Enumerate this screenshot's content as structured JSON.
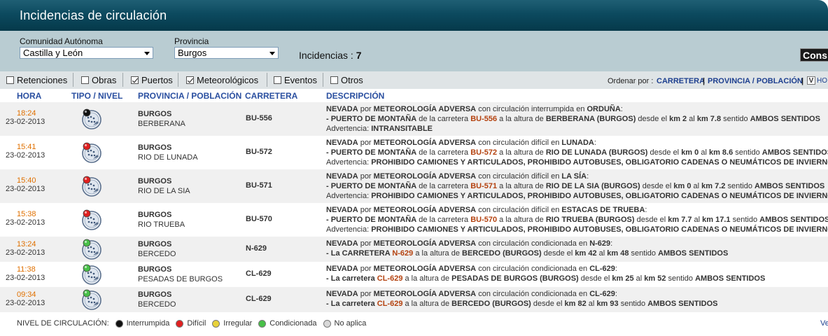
{
  "header": {
    "title": "Incidencias de circulación"
  },
  "filters": {
    "comunidad_label": "Comunidad Autónoma",
    "comunidad_value": "Castilla y León",
    "provincia_label": "Provincia",
    "provincia_value": "Burgos",
    "incidencias_label": "Incidencias :",
    "incidencias_count": "7",
    "consultar_label": "Cons"
  },
  "checks": [
    {
      "label": "Retenciones",
      "checked": false
    },
    {
      "label": "Obras",
      "checked": false
    },
    {
      "label": "Puertos",
      "checked": true
    },
    {
      "label": "Meteorológicos",
      "checked": true
    },
    {
      "label": "Eventos",
      "checked": false
    },
    {
      "label": "Otros",
      "checked": false
    }
  ],
  "order": {
    "label": "Ordenar por :",
    "carretera": "CARRETERA",
    "sep": "|",
    "provincia": "PROVINCIA / POBLACIÓN",
    "v": "V",
    "ho": "HO"
  },
  "columns": {
    "hora": "HORA",
    "tipo": "TIPO / NIVEL",
    "provincia": "PROVINCIA / POBLACIÓN",
    "carretera": "CARRETERA",
    "descripcion": "DESCRIPCIÓN"
  },
  "colors": {
    "negro": "#111111",
    "rojo": "#e02020",
    "amarillo": "#e8d23a",
    "verde": "#48c048",
    "gris": "#d8d8d8"
  },
  "rows": [
    {
      "time": "18:24",
      "date": "23-02-2013",
      "level": "negro",
      "provincia": "BURGOS",
      "poblacion": "BERBERANA",
      "road": "BU-556",
      "d1": [
        "NEVADA",
        " por ",
        "METEOROLOGÍA ADVERSA",
        " con circulación interrumpida en ",
        "ORDUÑA",
        ":"
      ],
      "d2": [
        "- PUERTO DE MONTAÑA",
        " de la carretera ",
        "BU-556",
        " a la altura de ",
        "BERBERANA (BURGOS)",
        " desde el ",
        "km 2",
        " al ",
        "km 7.8",
        " sentido ",
        "AMBOS SENTIDOS"
      ],
      "d3": [
        "Advertencia: ",
        "INTRANSITABLE"
      ]
    },
    {
      "time": "15:41",
      "date": "23-02-2013",
      "level": "rojo",
      "provincia": "BURGOS",
      "poblacion": "RIO DE LUNADA",
      "road": "BU-572",
      "d1": [
        "NEVADA",
        " por ",
        "METEOROLOGÍA ADVERSA",
        " con circulación difícil en ",
        "LUNADA",
        ":"
      ],
      "d2": [
        "- PUERTO DE MONTAÑA",
        " de la carretera ",
        "BU-572",
        " a la altura de ",
        "RIO DE LUNADA (BURGOS)",
        " desde el ",
        "km 0",
        " al ",
        "km 8.6",
        " sentido ",
        "AMBOS SENTIDOS"
      ],
      "d3": [
        "Advertencia: ",
        "PROHIBIDO CAMIONES Y ARTICULADOS, PROHIBIDO AUTOBUSES, OBLIGATORIO CADENAS O NEUMÁTICOS DE INVIERNO"
      ]
    },
    {
      "time": "15:40",
      "date": "23-02-2013",
      "level": "rojo",
      "provincia": "BURGOS",
      "poblacion": "RIO DE LA SIA",
      "road": "BU-571",
      "d1": [
        "NEVADA",
        " por ",
        "METEOROLOGÍA ADVERSA",
        " con circulación difícil en ",
        "LA SÍA",
        ":"
      ],
      "d2": [
        "- PUERTO DE MONTAÑA",
        " de la carretera ",
        "BU-571",
        " a la altura de ",
        "RIO DE LA SIA (BURGOS)",
        " desde el ",
        "km 0",
        " al ",
        "km 7.2",
        " sentido ",
        "AMBOS SENTIDOS"
      ],
      "d3": [
        "Advertencia: ",
        "PROHIBIDO CAMIONES Y ARTICULADOS, PROHIBIDO AUTOBUSES, OBLIGATORIO CADENAS O NEUMÁTICOS DE INVIERNO"
      ]
    },
    {
      "time": "15:38",
      "date": "23-02-2013",
      "level": "rojo",
      "provincia": "BURGOS",
      "poblacion": "RIO TRUEBA",
      "road": "BU-570",
      "d1": [
        "NEVADA",
        " por ",
        "METEOROLOGÍA ADVERSA",
        " con circulación difícil en ",
        "ESTACAS DE TRUEBA",
        ":"
      ],
      "d2": [
        "- PUERTO DE MONTAÑA",
        " de la carretera ",
        "BU-570",
        " a la altura de ",
        "RIO TRUEBA (BURGOS)",
        " desde el ",
        "km 7.7",
        " al ",
        "km 17.1",
        " sentido ",
        "AMBOS SENTIDOS"
      ],
      "d3": [
        "Advertencia: ",
        "PROHIBIDO CAMIONES Y ARTICULADOS, PROHIBIDO AUTOBUSES, OBLIGATORIO CADENAS O NEUMÁTICOS DE INVIERNO"
      ]
    },
    {
      "time": "13:24",
      "date": "23-02-2013",
      "level": "verde",
      "provincia": "BURGOS",
      "poblacion": "BERCEDO",
      "road": "N-629",
      "d1": [
        "NEVADA",
        " por ",
        "METEOROLOGÍA ADVERSA",
        " con circulación condicionada en ",
        "N-629",
        ":"
      ],
      "d2": [
        "- La CARRETERA ",
        "",
        "N-629",
        " a la altura de ",
        "BERCEDO (BURGOS)",
        " desde el ",
        "km 42",
        " al ",
        "km 48",
        " sentido ",
        "AMBOS SENTIDOS"
      ],
      "d3": null
    },
    {
      "time": "11:38",
      "date": "23-02-2013",
      "level": "verde",
      "provincia": "BURGOS",
      "poblacion": "PESADAS DE BURGOS",
      "road": "CL-629",
      "d1": [
        "NEVADA",
        " por ",
        "METEOROLOGÍA ADVERSA",
        " con circulación condicionada en ",
        "CL-629",
        ":"
      ],
      "d2": [
        "- La carretera ",
        "",
        "CL-629",
        " a la altura de ",
        "PESADAS DE BURGOS (BURGOS)",
        " desde el ",
        "km 25",
        " al ",
        "km 52",
        " sentido ",
        "AMBOS SENTIDOS"
      ],
      "d3": null
    },
    {
      "time": "09:34",
      "date": "23-02-2013",
      "level": "verde",
      "provincia": "BURGOS",
      "poblacion": "BERCEDO",
      "road": "CL-629",
      "d1": [
        "NEVADA",
        " por ",
        "METEOROLOGÍA ADVERSA",
        " con circulación condicionada en ",
        "CL-629",
        ":"
      ],
      "d2": [
        "- La carretera ",
        "",
        "CL-629",
        " a la altura de ",
        "BERCEDO (BURGOS)",
        " desde el ",
        "km 82",
        " al ",
        "km 93",
        " sentido ",
        "AMBOS SENTIDOS"
      ],
      "d3": null
    }
  ],
  "legend": {
    "title": "NIVEL DE CIRCULACIÓN:",
    "items": [
      {
        "label": "Interrumpida",
        "level": "negro"
      },
      {
        "label": "Difícil",
        "level": "rojo"
      },
      {
        "label": "Irregular",
        "level": "amarillo"
      },
      {
        "label": "Condicionada",
        "level": "verde"
      },
      {
        "label": "No aplica",
        "level": "gris"
      }
    ],
    "ver": "Ve"
  }
}
